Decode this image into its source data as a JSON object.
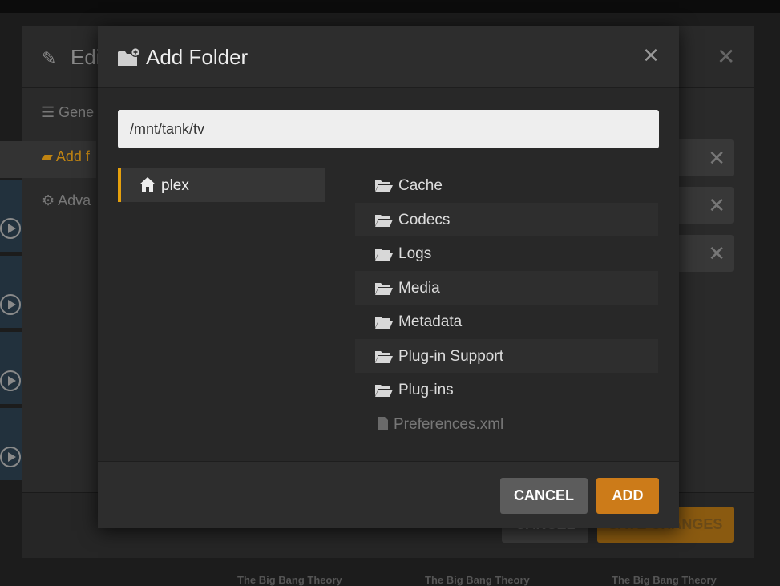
{
  "background": {
    "captions": [
      "The Big Bang Theory",
      "The Big Bang Theory",
      "The Big Bang Theory"
    ]
  },
  "under_dialog": {
    "title": "Edi",
    "nav": [
      "Gene",
      "Add f",
      "Adva"
    ],
    "cancel_label": "CANCEL",
    "save_label": "SAVE CHANGES"
  },
  "modal": {
    "title": "Add Folder",
    "path_value": "/mnt/tank/tv",
    "root_label": "plex",
    "items": [
      {
        "name": "Cache",
        "type": "folder"
      },
      {
        "name": "Codecs",
        "type": "folder"
      },
      {
        "name": "Logs",
        "type": "folder"
      },
      {
        "name": "Media",
        "type": "folder"
      },
      {
        "name": "Metadata",
        "type": "folder"
      },
      {
        "name": "Plug-in Support",
        "type": "folder"
      },
      {
        "name": "Plug-ins",
        "type": "folder"
      },
      {
        "name": "Preferences.xml",
        "type": "file"
      }
    ],
    "cancel_label": "CANCEL",
    "add_label": "ADD"
  },
  "colors": {
    "accent": "#e5a00d",
    "add_button": "#cc7b19",
    "cancel_button": "#5c5c5c"
  }
}
